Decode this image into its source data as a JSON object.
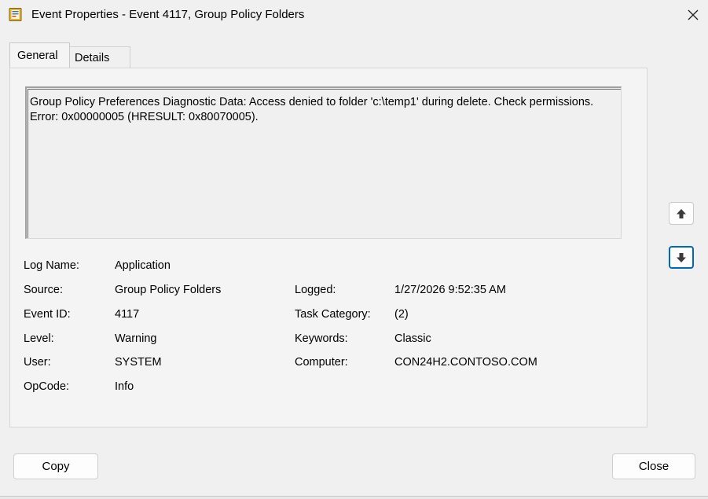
{
  "window": {
    "title": "Event Properties - Event 4117, Group Policy Folders",
    "app_icon": "event-viewer-icon",
    "close_icon": "close-icon"
  },
  "tabs": [
    {
      "label": "General",
      "active": true
    },
    {
      "label": "Details",
      "active": false
    }
  ],
  "description": "Group Policy Preferences Diagnostic Data: Access denied to folder 'c:\\temp1' during delete. Check permissions. Error: 0x00000005 (HRESULT: 0x80070005).",
  "fields": {
    "log_name": {
      "label": "Log Name:",
      "value": "Application"
    },
    "source": {
      "label": "Source:",
      "value": "Group Policy Folders"
    },
    "logged": {
      "label": "Logged:",
      "value": "1/27/2026 9:52:35 AM"
    },
    "event_id": {
      "label": "Event ID:",
      "value": "4117"
    },
    "task_category": {
      "label": "Task Category:",
      "value": "(2)"
    },
    "level": {
      "label": "Level:",
      "value": "Warning"
    },
    "keywords": {
      "label": "Keywords:",
      "value": "Classic"
    },
    "user": {
      "label": "User:",
      "value": "SYSTEM"
    },
    "computer": {
      "label": "Computer:",
      "value": "CON24H2.CONTOSO.COM"
    },
    "opcode": {
      "label": "OpCode:",
      "value": "Info"
    }
  },
  "nav": {
    "previous_icon": "arrow-up-icon",
    "next_icon": "arrow-down-icon"
  },
  "buttons": {
    "copy": "Copy",
    "close": "Close"
  },
  "colors": {
    "window_bg": "#f0f0f0",
    "focus_accent": "#0067c0"
  }
}
